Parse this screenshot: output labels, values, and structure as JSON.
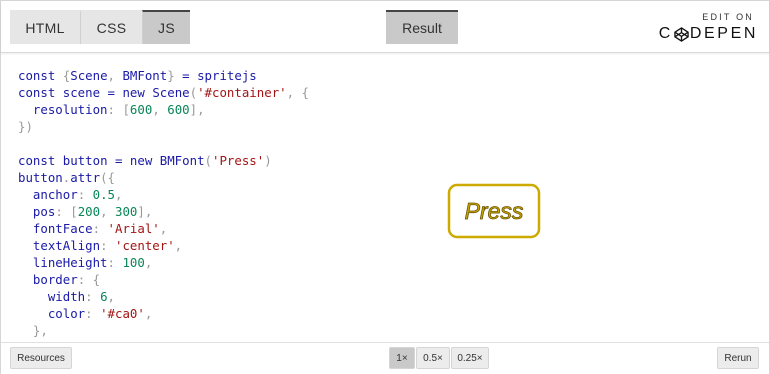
{
  "header": {
    "tabs": [
      {
        "label": "HTML",
        "active": false
      },
      {
        "label": "CSS",
        "active": false
      },
      {
        "label": "JS",
        "active": true
      }
    ],
    "result_label": "Result",
    "codepen": {
      "edit_on": "EDIT ON",
      "logo_left": "C",
      "logo_right": "DEPEN"
    }
  },
  "code": {
    "lines": [
      [
        [
          "kw",
          "const "
        ],
        [
          "pn",
          "{"
        ],
        [
          "cls",
          "Scene"
        ],
        [
          "pn",
          ", "
        ],
        [
          "cls",
          "BMFont"
        ],
        [
          "pn",
          "}"
        ],
        [
          "kw",
          " = "
        ],
        [
          "id",
          "spritejs"
        ]
      ],
      [
        [
          "kw",
          "const "
        ],
        [
          "var",
          "scene"
        ],
        [
          "kw",
          " = "
        ],
        [
          "kw",
          "new "
        ],
        [
          "cls",
          "Scene"
        ],
        [
          "pn",
          "("
        ],
        [
          "str",
          "'#container'"
        ],
        [
          "pn",
          ", {"
        ]
      ],
      [
        [
          "pn",
          "  "
        ],
        [
          "prop",
          "resolution"
        ],
        [
          "pn",
          ": ["
        ],
        [
          "num",
          "600"
        ],
        [
          "pn",
          ", "
        ],
        [
          "num",
          "600"
        ],
        [
          "pn",
          "],"
        ]
      ],
      [
        [
          "pn",
          "})"
        ]
      ],
      [
        [
          "pn",
          ""
        ]
      ],
      [
        [
          "kw",
          "const "
        ],
        [
          "var",
          "button"
        ],
        [
          "kw",
          " = "
        ],
        [
          "kw",
          "new "
        ],
        [
          "cls",
          "BMFont"
        ],
        [
          "pn",
          "("
        ],
        [
          "str",
          "'Press'"
        ],
        [
          "pn",
          ")"
        ]
      ],
      [
        [
          "var",
          "button"
        ],
        [
          "pn",
          "."
        ],
        [
          "id",
          "attr"
        ],
        [
          "pn",
          "({"
        ]
      ],
      [
        [
          "pn",
          "  "
        ],
        [
          "prop",
          "anchor"
        ],
        [
          "pn",
          ": "
        ],
        [
          "num",
          "0.5"
        ],
        [
          "pn",
          ","
        ]
      ],
      [
        [
          "pn",
          "  "
        ],
        [
          "prop",
          "pos"
        ],
        [
          "pn",
          ": ["
        ],
        [
          "num",
          "200"
        ],
        [
          "pn",
          ", "
        ],
        [
          "num",
          "300"
        ],
        [
          "pn",
          "],"
        ]
      ],
      [
        [
          "pn",
          "  "
        ],
        [
          "prop",
          "fontFace"
        ],
        [
          "pn",
          ": "
        ],
        [
          "str",
          "'Arial'"
        ],
        [
          "pn",
          ","
        ]
      ],
      [
        [
          "pn",
          "  "
        ],
        [
          "prop",
          "textAlign"
        ],
        [
          "pn",
          ": "
        ],
        [
          "str",
          "'center'"
        ],
        [
          "pn",
          ","
        ]
      ],
      [
        [
          "pn",
          "  "
        ],
        [
          "prop",
          "lineHeight"
        ],
        [
          "pn",
          ": "
        ],
        [
          "num",
          "100"
        ],
        [
          "pn",
          ","
        ]
      ],
      [
        [
          "pn",
          "  "
        ],
        [
          "prop",
          "border"
        ],
        [
          "pn",
          ": {"
        ]
      ],
      [
        [
          "pn",
          "    "
        ],
        [
          "prop",
          "width"
        ],
        [
          "pn",
          ": "
        ],
        [
          "num",
          "6"
        ],
        [
          "pn",
          ","
        ]
      ],
      [
        [
          "pn",
          "    "
        ],
        [
          "prop",
          "color"
        ],
        [
          "pn",
          ": "
        ],
        [
          "str",
          "'#ca0'"
        ],
        [
          "pn",
          ","
        ]
      ],
      [
        [
          "pn",
          "  },"
        ]
      ]
    ]
  },
  "preview": {
    "text": "Press",
    "border_color": "#ca0",
    "fill_color": "#ca0"
  },
  "footer": {
    "resources_label": "Resources",
    "zoom_options": [
      "1×",
      "0.5×",
      "0.25×"
    ],
    "rerun_label": "Rerun"
  }
}
